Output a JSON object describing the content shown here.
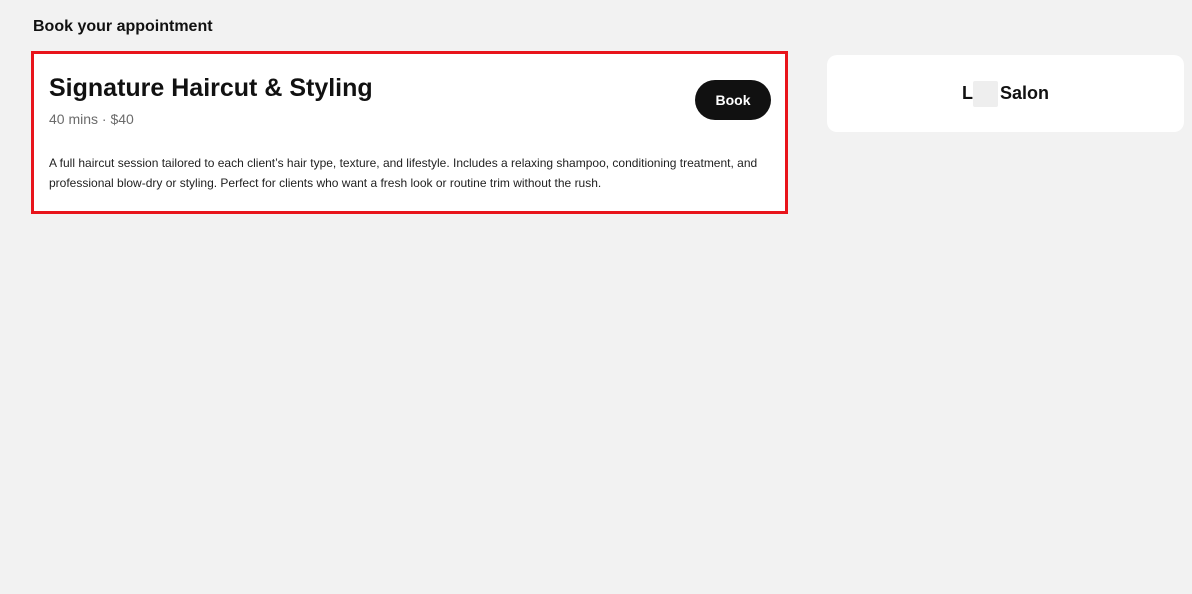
{
  "page": {
    "title": "Book your appointment"
  },
  "service": {
    "title": "Signature Haircut & Styling",
    "meta": "40 mins · $40",
    "book_label": "Book",
    "description": "A full haircut session tailored to each client’s hair type, texture, and lifestyle. Includes a relaxing shampoo, conditioning treatment, and professional blow-dry or styling. Perfect for clients who want a fresh look or routine trim without the rush."
  },
  "salon": {
    "name_initial": "L",
    "name_rest": "Salon"
  },
  "colors": {
    "background": "#f2f2f2",
    "card": "#ffffff",
    "highlight_border": "#e8141b",
    "button": "#111111",
    "muted_text": "#6b6b6b"
  }
}
